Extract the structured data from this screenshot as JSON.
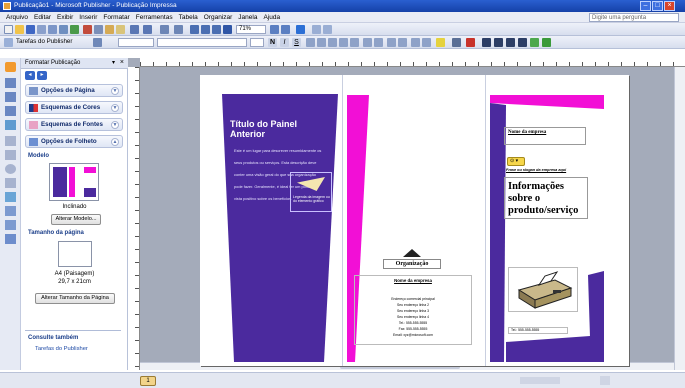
{
  "window": {
    "title": "Publicação1 - Microsoft Publisher - Publicação Impressa"
  },
  "menu": {
    "items": [
      "Arquivo",
      "Editar",
      "Exibir",
      "Inserir",
      "Formatar",
      "Ferramentas",
      "Tabela",
      "Organizar",
      "Janela",
      "Ajuda"
    ],
    "ask_placeholder": "Digite uma pergunta"
  },
  "toolbar": {
    "zoom": "71%"
  },
  "toolbar2": {
    "tasks_label": "Tarefas do Publisher"
  },
  "task_pane": {
    "title": "Formatar Publicação",
    "sections": {
      "page_options": "Opções de Página",
      "color_schemes": "Esquemas de Cores",
      "font_schemes": "Esquemas de Fontes",
      "brochure_options": "Opções de Folheto"
    },
    "model_label": "Modelo",
    "model_name": "Inclinado",
    "change_model_button": "Alterar Modelo...",
    "page_size_label": "Tamanho da página",
    "page_size_name": "A4 (Paisagem)",
    "page_size_dims": "29,7 x 21cm",
    "change_page_size_button": "Alterar Tamanho da Página",
    "see_also_label": "Consulte também",
    "see_also_link": "Tarefas do Publisher"
  },
  "brochure": {
    "left_title": "Título do Painel Anterior",
    "left_body": "Este é um lugar para descrever resumidamente os seus produtos ou serviços. Esta descrição deve conter uma visão geral do que sua organização pode fazer. Geralmente, é ideal ter um ponto de vista positivo sobre os benefícios.",
    "caption": "Legenda da imagem ou do elemento gráfico",
    "org_label": "Organização",
    "company_name_mid": "Nome da empresa",
    "address_lines": [
      "Endereço comercial principal",
      "Seu endereço linha 2",
      "Seu endereço linha 3",
      "Seu endereço linha 4"
    ],
    "phone_lines": [
      "Tel.: 555-555-5555",
      "Fax: 555-555-5555",
      "Email: xyz@microsoft.com"
    ],
    "company_name_right": "Nome da empresa",
    "tagline": "Frase ou slogan da empresa aqui",
    "info_title": "Informações sobre o produto/serviço",
    "phone_right": "Tel.: 555-555-5555"
  },
  "colors": {
    "purple": "#4b2a9e",
    "magenta": "#f20fd6",
    "titlebar": "#1f4fbf"
  }
}
